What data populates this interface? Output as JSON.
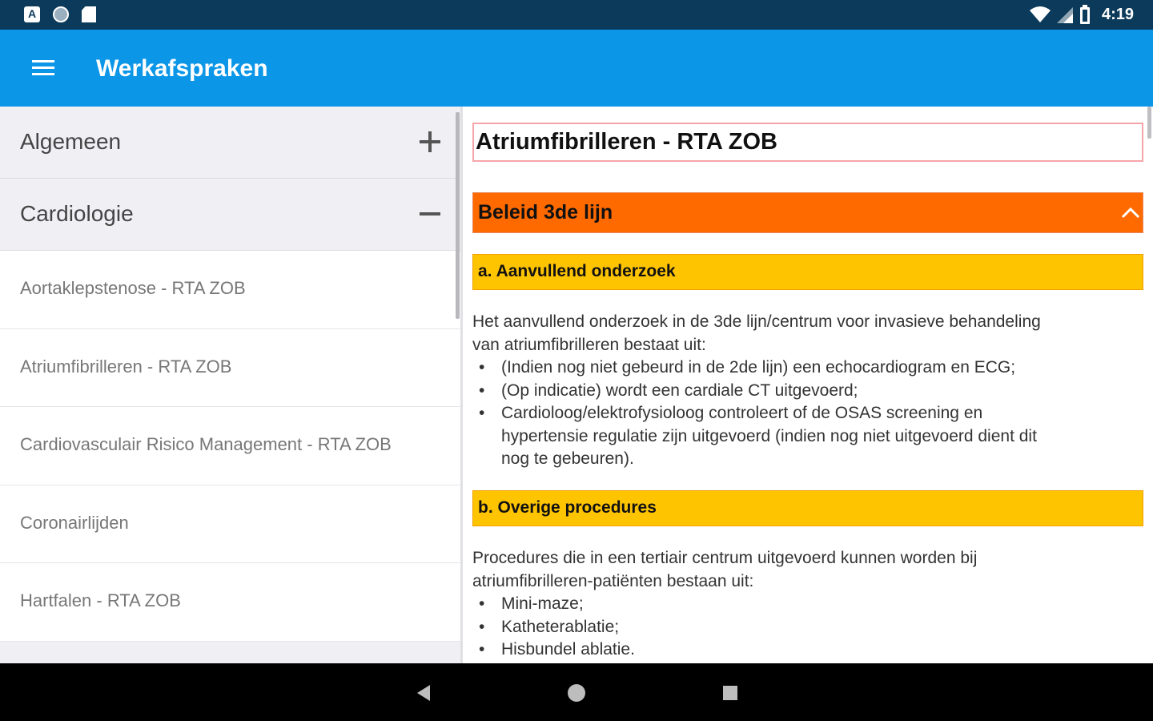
{
  "status_bar": {
    "time": "4:19",
    "icons": [
      "a-notification-icon",
      "circle-notification-icon",
      "sd-card-icon",
      "wifi-icon",
      "cell-signal-icon",
      "battery-icon"
    ]
  },
  "app_bar": {
    "title": "Werkafspraken",
    "menu_icon": "hamburger-menu-icon"
  },
  "sidebar": {
    "groups": [
      {
        "label": "Algemeen",
        "toggle": "+"
      },
      {
        "label": "Cardiologie",
        "toggle": "-"
      }
    ],
    "items": [
      {
        "label": "Aortaklepstenose - RTA ZOB"
      },
      {
        "label": "Atriumfibrilleren - RTA ZOB"
      },
      {
        "label": "Cardiovasculair Risico Management - RTA ZOB"
      },
      {
        "label": "Coronairlijden"
      },
      {
        "label": "Hartfalen - RTA ZOB"
      }
    ]
  },
  "content": {
    "title": "Atriumfibrilleren - RTA ZOB",
    "section": {
      "label": "Beleid 3de lijn",
      "icon": "chevron-up-icon"
    },
    "sub_a": {
      "label": "a. Aanvullend onderzoek",
      "intro_1": "Het aanvullend onderzoek in de 3de lijn/centrum voor invasieve behandeling",
      "intro_2": "van atriumfibrilleren bestaat uit:",
      "bullets": [
        "(Indien nog niet gebeurd in de 2de lijn) een echocardiogram en ECG;",
        "(Op indicatie) wordt een cardiale CT uitgevoerd;"
      ],
      "bullet3_line1": "Cardioloog/elektrofysioloog controleert of de OSAS screening en",
      "bullet3_line2": "hypertensie regulatie zijn uitgevoerd (indien nog niet uitgevoerd dient dit",
      "bullet3_line3": "nog te gebeuren)."
    },
    "sub_b": {
      "label": "b. Overige procedures",
      "intro_1": "Procedures die in een tertiair centrum uitgevoerd kunnen worden bij",
      "intro_2": "atriumfibrilleren-patiënten bestaan uit:",
      "bullets": [
        "Mini-maze;",
        "Katheterablatie;",
        "Hisbundel ablatie."
      ]
    }
  },
  "nav_bar": {
    "icons": [
      "back-triangle-icon",
      "home-circle-icon",
      "recents-square-icon"
    ]
  },
  "colors": {
    "status_bar": "#0b3a5a",
    "app_bar": "#0b96e8",
    "section_orange": "#ff6a00",
    "sub_yellow": "#ffc400",
    "sidebar_group_bg": "#efeff4"
  }
}
